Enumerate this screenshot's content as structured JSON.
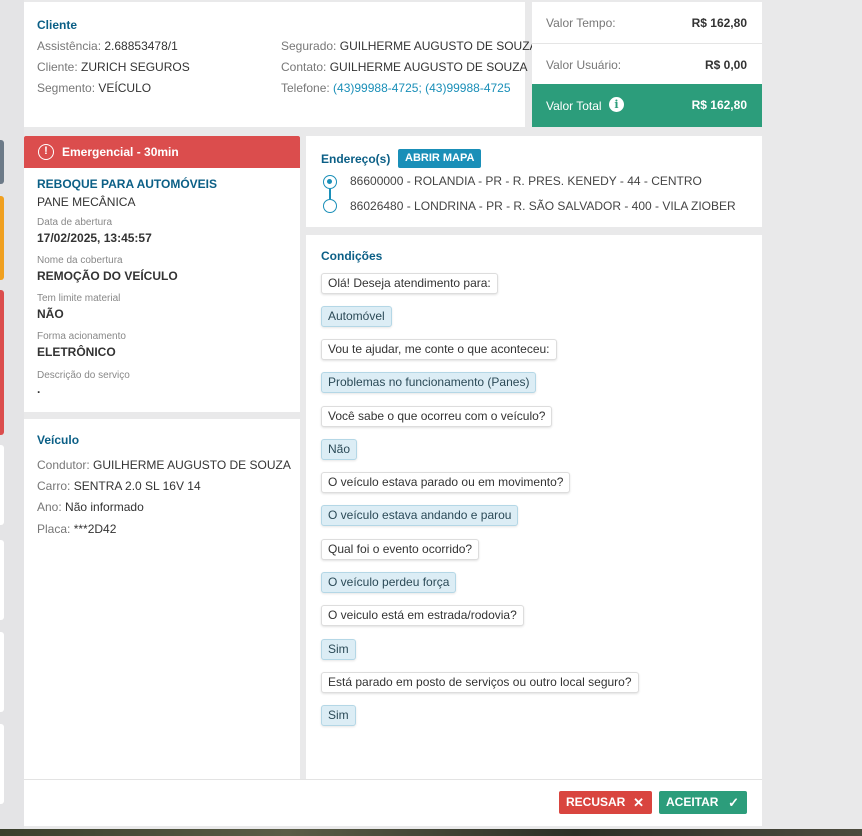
{
  "client": {
    "title": "Cliente",
    "assistencia_label": "Assistência:",
    "assistencia": "2.68853478/1",
    "cliente_label": "Cliente:",
    "cliente": "ZURICH SEGUROS",
    "segmento_label": "Segmento:",
    "segmento": "VEÍCULO",
    "segurado_label": "Segurado:",
    "segurado": "GUILHERME AUGUSTO DE SOUZA",
    "contato_label": "Contato:",
    "contato": "GUILHERME AUGUSTO DE SOUZA",
    "telefone_label": "Telefone:",
    "telefone": "(43)99988-4725; (43)99988-4725"
  },
  "values": {
    "tempo_label": "Valor Tempo:",
    "tempo": "R$ 162,80",
    "usuario_label": "Valor Usuário:",
    "usuario": "R$ 0,00",
    "total_label": "Valor Total",
    "total": "R$ 162,80",
    "accent": "#2c9d7b"
  },
  "service": {
    "badge": "Emergencial - 30min",
    "badge_color": "#db4d4d",
    "type": "REBOQUE PARA AUTOMÓVEIS",
    "subtype": "PANE MECÂNICA",
    "data_label": "Data de abertura",
    "data": "17/02/2025, 13:45:57",
    "cobertura_label": "Nome da cobertura",
    "cobertura": "REMOÇÃO DO VEÍCULO",
    "limite_label": "Tem limite material",
    "limite": "NÃO",
    "forma_label": "Forma acionamento",
    "forma": "ELETRÔNICO",
    "descricao_label": "Descrição do serviço",
    "descricao": "."
  },
  "vehicle": {
    "title": "Veículo",
    "condutor_label": "Condutor:",
    "condutor": "GUILHERME AUGUSTO DE SOUZA",
    "carro_label": "Carro:",
    "carro": "SENTRA 2.0 SL 16V 14",
    "ano_label": "Ano:",
    "ano": "Não informado",
    "placa_label": "Placa:",
    "placa": "***2D42"
  },
  "address": {
    "title": "Endereço(s)",
    "map_button": "ABRIR MAPA",
    "origin": "86600000 - ROLANDIA - PR - R. PRES. KENEDY - 44 - CENTRO",
    "destination": "86026480 - LONDRINA - PR - R. SÃO SALVADOR - 400 - VILA ZIOBER"
  },
  "conditions": {
    "title": "Condições",
    "items": [
      {
        "kind": "q",
        "text": "Olá! Deseja atendimento para:"
      },
      {
        "kind": "a",
        "text": "Automóvel"
      },
      {
        "kind": "q",
        "text": "Vou te ajudar, me conte o que aconteceu:"
      },
      {
        "kind": "a",
        "text": "Problemas no funcionamento (Panes)"
      },
      {
        "kind": "q",
        "text": "Você sabe o que ocorreu com o veículo?"
      },
      {
        "kind": "a",
        "text": "Não"
      },
      {
        "kind": "q",
        "text": "O veículo estava parado ou em movimento?"
      },
      {
        "kind": "a",
        "text": "O veículo estava andando e parou"
      },
      {
        "kind": "q",
        "text": "Qual foi o evento ocorrido?"
      },
      {
        "kind": "a",
        "text": "O veículo perdeu força"
      },
      {
        "kind": "q",
        "text": "O veiculo está em estrada/rodovia?"
      },
      {
        "kind": "a",
        "text": "Sim"
      },
      {
        "kind": "q",
        "text": "Está parado em posto de serviços ou outro local seguro?"
      },
      {
        "kind": "a",
        "text": "Sim"
      }
    ]
  },
  "footer": {
    "recusar": "RECUSAR",
    "aceitar": "ACEITAR",
    "recusar_color": "#d9453f",
    "aceitar_color": "#2c9d7b"
  }
}
